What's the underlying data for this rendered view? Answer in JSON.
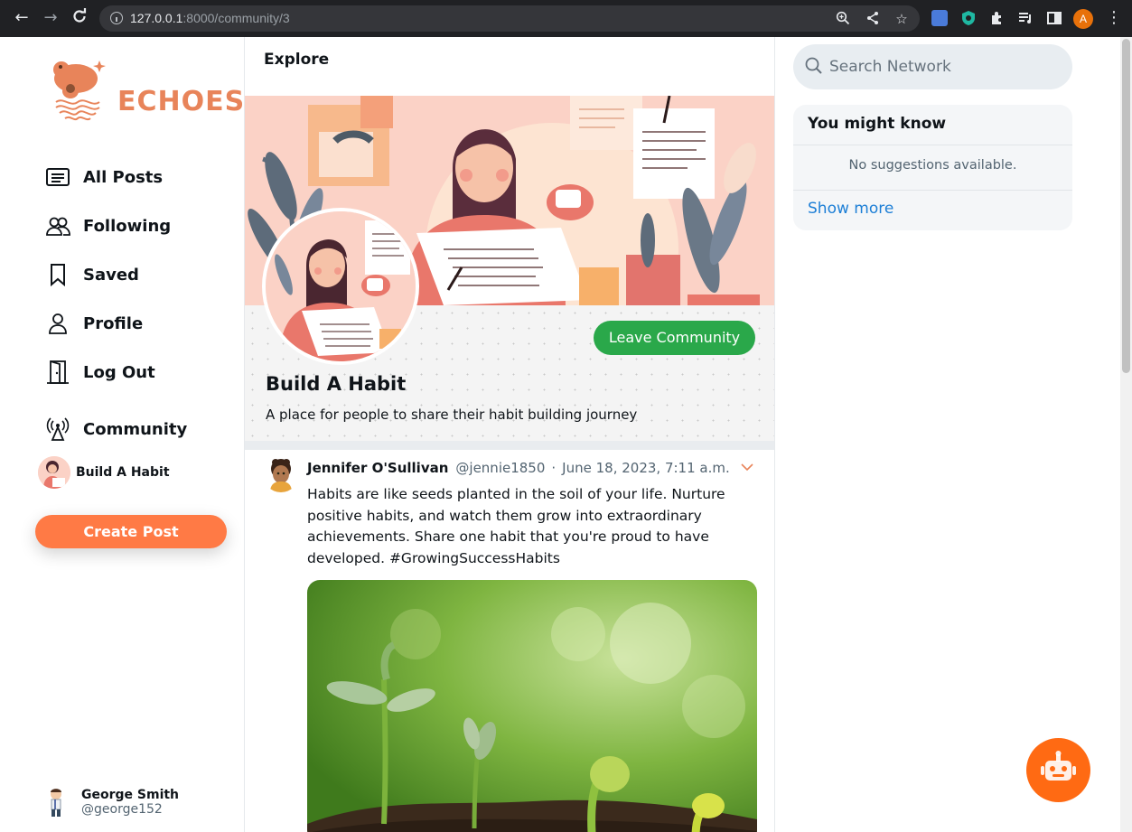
{
  "browser": {
    "url_host": "127.0.0.1",
    "url_rest": ":8000/community/3",
    "profile_initial": "A"
  },
  "brand": {
    "name": "ECHOES",
    "color": "#e8845a"
  },
  "nav": {
    "items": [
      {
        "label": "All Posts",
        "icon": "post-list-icon"
      },
      {
        "label": "Following",
        "icon": "users-icon"
      },
      {
        "label": "Saved",
        "icon": "bookmark-icon"
      },
      {
        "label": "Profile",
        "icon": "user-icon"
      },
      {
        "label": "Log Out",
        "icon": "door-icon"
      },
      {
        "label": "Community",
        "icon": "broadcast-tower-icon"
      }
    ],
    "community_link": "Build A Habit",
    "create_post": "Create Post"
  },
  "current_user": {
    "name": "George Smith",
    "handle": "@george152"
  },
  "main": {
    "header": "Explore",
    "community": {
      "title": "Build A Habit",
      "description": "A place for people to share their habit building journey",
      "leave_label": "Leave Community"
    },
    "post": {
      "author": "Jennifer O'Sullivan",
      "handle": "@jennie1850",
      "separator": "·",
      "date": "June 18, 2023, 7:11 a.m.",
      "text": "Habits are like seeds planted in the soil of your life. Nurture positive habits, and watch them grow into extraordinary achievements. Share one habit that you're proud to have developed. #GrowingSuccessHabits"
    }
  },
  "right": {
    "search_placeholder": "Search Network",
    "you_might_know": {
      "title": "You might know",
      "empty": "No suggestions available.",
      "show_more": "Show more"
    }
  },
  "colors": {
    "accent": "#ff7a45",
    "leave": "#2aa84a",
    "link": "#1d7fd6",
    "bot": "#ff6a13"
  }
}
